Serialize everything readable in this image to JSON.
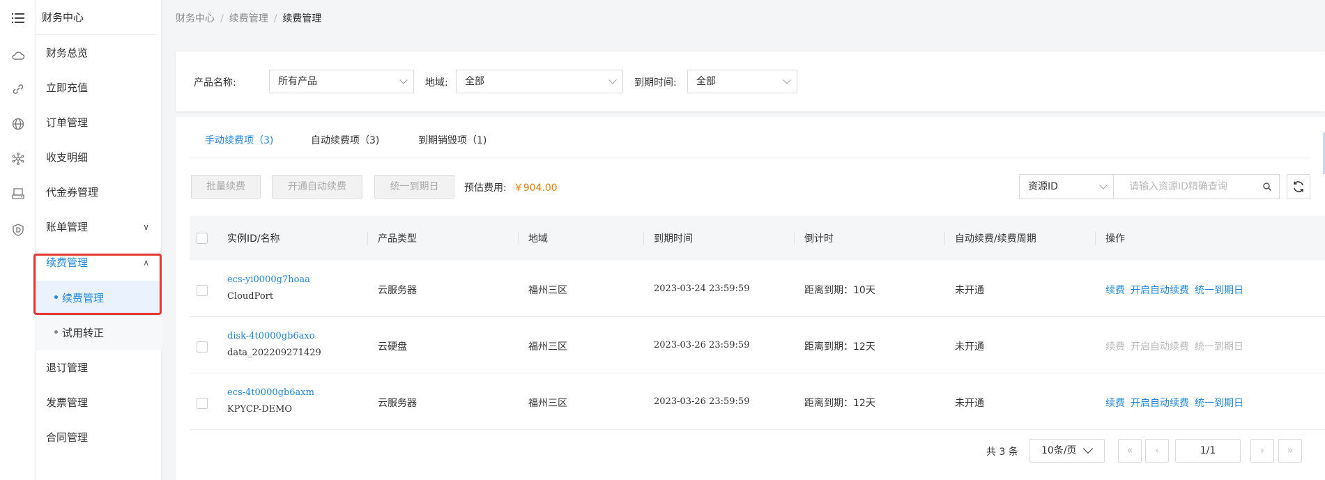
{
  "sidebar": {
    "title": "财务中心",
    "items": [
      {
        "label": "财务总览"
      },
      {
        "label": "立即充值"
      },
      {
        "label": "订单管理"
      },
      {
        "label": "收支明细"
      },
      {
        "label": "代金券管理"
      },
      {
        "label": "账单管理"
      },
      {
        "label": "续费管理"
      },
      {
        "label": "退订管理"
      },
      {
        "label": "发票管理"
      },
      {
        "label": "合同管理"
      }
    ],
    "subitems": [
      {
        "label": "续费管理"
      },
      {
        "label": "试用转正"
      }
    ]
  },
  "breadcrumb": [
    "财务中心",
    "续费管理",
    "续费管理"
  ],
  "filters": {
    "product_label": "产品名称:",
    "product_value": "所有产品",
    "region_label": "地域:",
    "region_value": "全部",
    "expire_label": "到期时间:",
    "expire_value": "全部"
  },
  "tabs": [
    {
      "label": "手动续费项（3)"
    },
    {
      "label": "自动续费项（3)"
    },
    {
      "label": "到期销毁项（1)"
    }
  ],
  "toolbar": {
    "batch_renew": "批量续费",
    "enable_auto": "开通自动续费",
    "unify_expiry": "统一到期日",
    "estimate_label": "预估费用:",
    "estimate_amount": "￥904.00",
    "resource_select": "资源ID",
    "resource_placeholder": "请输入资源ID精确查询"
  },
  "table": {
    "headers": [
      "实例ID/名称",
      "产品类型",
      "地域",
      "到期时间",
      "倒计时",
      "自动续费/续费周期",
      "操作"
    ],
    "rows": [
      {
        "id": "ecs-yi0000g7hoaa",
        "name": "CloudPort",
        "type": "云服务器",
        "region": "福州三区",
        "expire": "2023-03-24 23:59:59",
        "countdown": "距离到期：10天",
        "auto": "未开通",
        "ops": [
          "续费",
          "开启自动续费",
          "统一到期日"
        ],
        "ops_enabled": true
      },
      {
        "id": "disk-4t0000gb6axo",
        "name": "data_202209271429",
        "type": "云硬盘",
        "region": "福州三区",
        "expire": "2023-03-26 23:59:59",
        "countdown": "距离到期：12天",
        "auto": "未开通",
        "ops": [
          "续费",
          "开启自动续费",
          "统一到期日"
        ],
        "ops_enabled": false
      },
      {
        "id": "ecs-4t0000gb6axm",
        "name": "KPYCP-DEMO",
        "type": "云服务器",
        "region": "福州三区",
        "expire": "2023-03-26 23:59:59",
        "countdown": "距离到期：12天",
        "auto": "未开通",
        "ops": [
          "续费",
          "开启自动续费",
          "统一到期日"
        ],
        "ops_enabled": true
      }
    ]
  },
  "pager": {
    "total": "共 3 条",
    "page_size": "10条/页",
    "page": "1/1"
  },
  "colors": {
    "accent": "#1e88e5",
    "amount": "#f57c00",
    "highlight": "#e53935"
  }
}
